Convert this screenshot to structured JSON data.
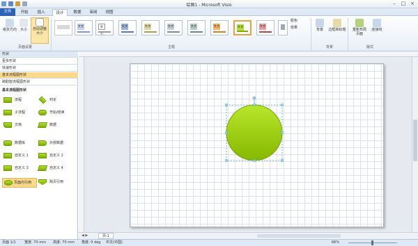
{
  "title": "绘图1 - Microsoft Visio",
  "tabs": [
    "文件",
    "开始",
    "插入",
    "设计",
    "数据",
    "审阅",
    "视图"
  ],
  "active_tab": "设计",
  "page_setup": {
    "orientation": "纸张方向",
    "size": "大小",
    "autofit_line1": "自动调整",
    "autofit_line2": "大小",
    "group": "页面设置"
  },
  "themes": {
    "label": "文文",
    "group": "主题"
  },
  "colors": "颜色",
  "effects": "效果",
  "background": {
    "bg": "背景",
    "border": "边框和标题",
    "group": "背景"
  },
  "layout": {
    "relayout": "重新布局",
    "relayout2": "页面",
    "connector": "连接线",
    "group": "版式"
  },
  "shapes_panel": {
    "title": "形状",
    "more": "更多形状",
    "quick": "快速形状",
    "basic_flow": "基本流程图形状",
    "cross_flow": "跨职能流程图形状",
    "section": "基本流程图形状",
    "items": [
      {
        "left": "流程",
        "right": "判定"
      },
      {
        "left": "子流程",
        "right": "开始/结束"
      },
      {
        "left": "文档",
        "right": "数据"
      },
      {
        "left": "数据库",
        "right": "外部数据"
      },
      {
        "left": "自定义 1",
        "right": "自定义 2"
      },
      {
        "left": "自定义 3",
        "right": "自定义 4"
      },
      {
        "left": "页面内引用",
        "right": "跨页引用"
      }
    ]
  },
  "page_tab": "页-1",
  "status": {
    "page": "页面 1/1",
    "width": "宽度: 70 mm",
    "height": "高度: 70 mm",
    "angle": "角度: 0 deg",
    "lang": "中文(中国)",
    "zoom": "66%"
  },
  "accent": "#2a63b8",
  "shape_color": "#9bd11a"
}
